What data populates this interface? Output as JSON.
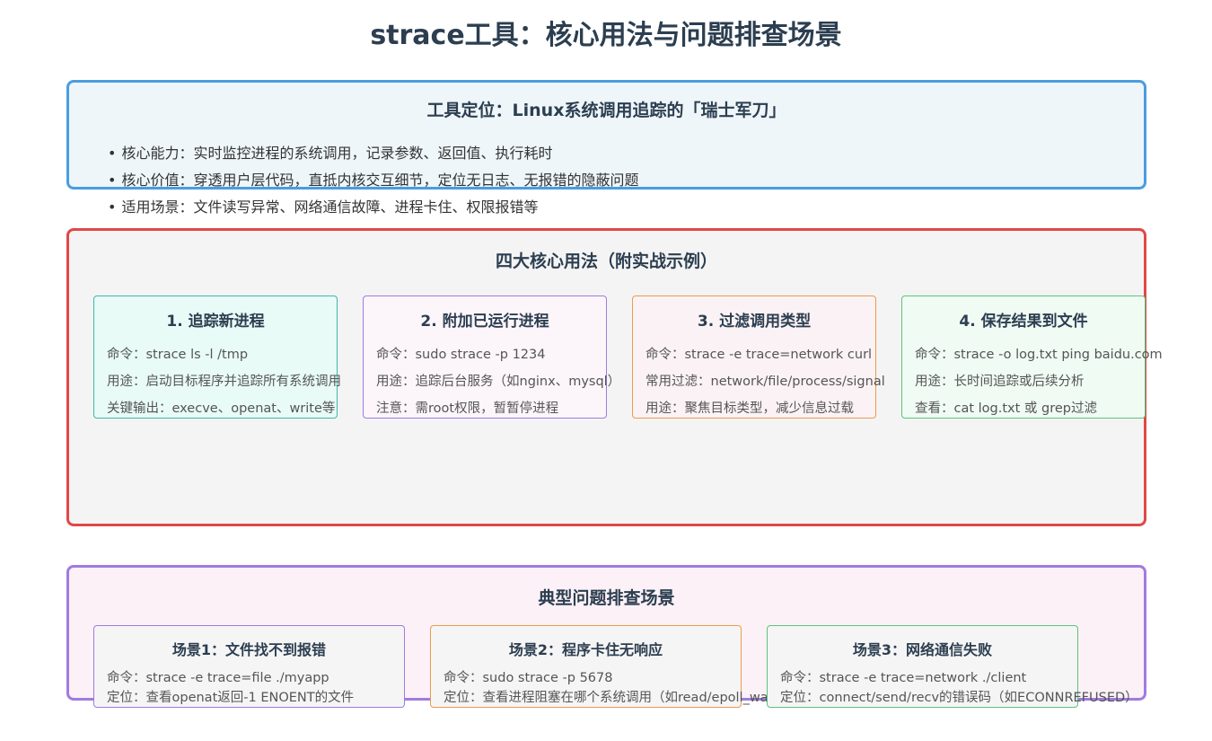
{
  "title": "strace工具：核心用法与问题排查场景",
  "intro": {
    "title": "工具定位：Linux系统调用追踪的「瑞士军刀」",
    "bullets": [
      "核心能力：实时监控进程的系统调用，记录参数、返回值、执行耗时",
      "核心价值：穿透用户层代码，直抵内核交互细节，定位无日志、无报错的隐蔽问题",
      "适用场景：文件读写异常、网络通信故障、进程卡住、权限报错等"
    ]
  },
  "usage": {
    "title": "四大核心用法（附实战示例）",
    "cards": [
      {
        "title": "1. 追踪新进程",
        "lines": [
          "命令：strace ls -l /tmp",
          "用途：启动目标程序并追踪所有系统调用",
          "关键输出：execve、openat、write等"
        ],
        "border": "#3fb8a8",
        "bg": "#e8fbf7"
      },
      {
        "title": "2. 附加已运行进程",
        "lines": [
          "命令：sudo strace -p 1234",
          "用途：追踪后台服务（如nginx、mysql）",
          "注意：需root权限，暂暂停进程"
        ],
        "border": "#a07be0",
        "bg": "#fcf5fa"
      },
      {
        "title": "3. 过滤调用类型",
        "lines": [
          "命令：strace -e trace=network curl",
          "常用过滤：network/file/process/signal",
          "用途：聚焦目标类型，减少信息过载"
        ],
        "border": "#ef9a4a",
        "bg": "#fbf2f5"
      },
      {
        "title": "4. 保存结果到文件",
        "lines": [
          "命令：strace -o log.txt ping baidu.com",
          "用途：长时间追踪或后续分析",
          "查看：cat log.txt 或 grep过滤"
        ],
        "border": "#5cc47e",
        "bg": "#effbf3"
      }
    ]
  },
  "scenarios": {
    "title": "典型问题排查场景",
    "cards": [
      {
        "title": "场景1：文件找不到报错",
        "lines": [
          "命令：strace -e trace=file ./myapp",
          "定位：查看openat返回-1 ENOENT的文件"
        ],
        "border": "#a07be0"
      },
      {
        "title": "场景2：程序卡住无响应",
        "lines": [
          "命令：sudo strace -p 5678",
          "定位：查看进程阻塞在哪个系统调用（如read/epoll_wait）"
        ],
        "border": "#ef9a4a"
      },
      {
        "title": "场景3：网络通信失败",
        "lines": [
          "命令：strace -e trace=network ./client",
          "定位：connect/send/recv的错误码（如ECONNREFUSED）"
        ],
        "border": "#5cc47e"
      }
    ]
  }
}
